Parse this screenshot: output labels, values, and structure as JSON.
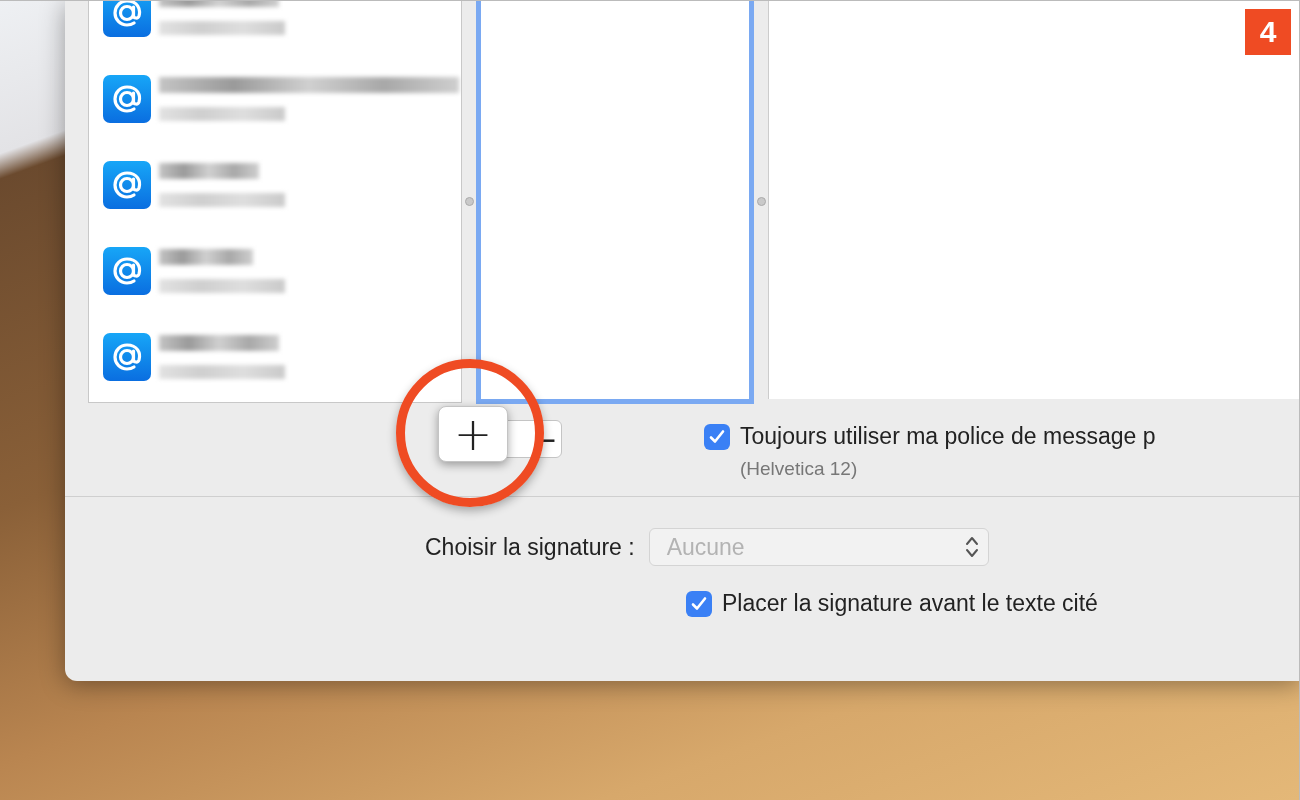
{
  "step_badge": "4",
  "accounts": [
    {
      "kind": "email"
    },
    {
      "kind": "email"
    },
    {
      "kind": "email"
    },
    {
      "kind": "email"
    },
    {
      "kind": "email"
    }
  ],
  "signature_list": {
    "focused": true
  },
  "list_buttons": [
    {
      "label": "+",
      "kind": "add"
    },
    {
      "label": "−",
      "kind": "remove"
    }
  ],
  "font_option": {
    "label": "Toujours utiliser ma police de message p",
    "checked": true,
    "detail": "(Helvetica 12)"
  },
  "signature_popup": {
    "label": "Choisir la signature :",
    "value": "Aucune",
    "disabled": true
  },
  "place_option": {
    "label": "Placer la signature avant le texte cité",
    "checked": true
  }
}
